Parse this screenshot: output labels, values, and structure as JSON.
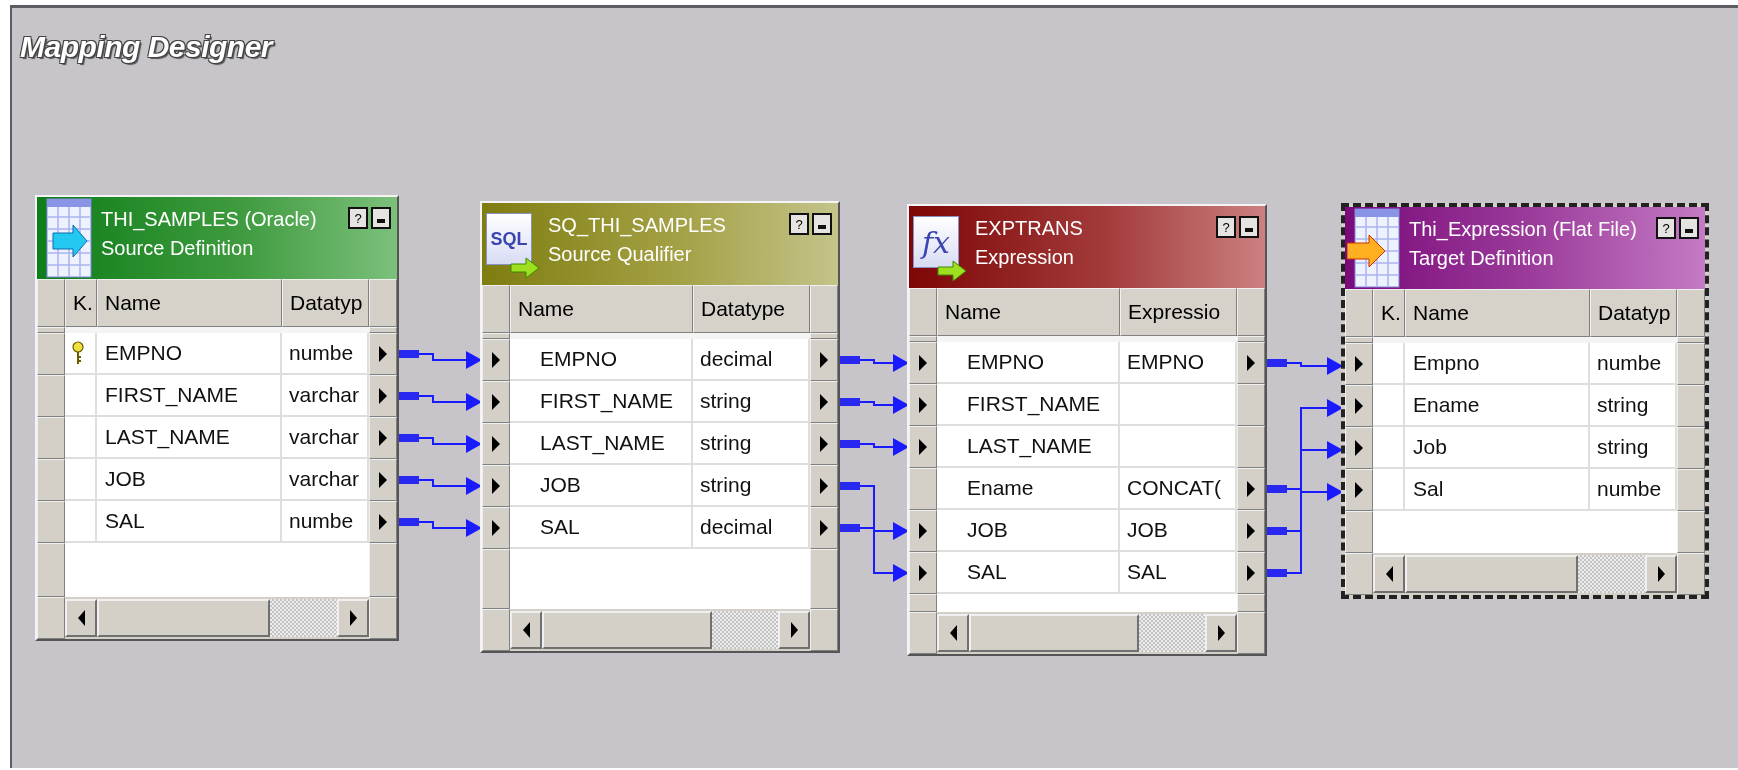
{
  "window": {
    "title": "Mapping Designer"
  },
  "nodes": [
    {
      "kind": "source",
      "selected": false,
      "title": "THI_SAMPLES (Oracle)",
      "subtitle": "Source Definition",
      "help": "?",
      "columns": [
        "K.",
        "Name",
        "Datatyp"
      ],
      "rows": [
        {
          "key": true,
          "name": "EMPNO",
          "value": "numbe",
          "input": false,
          "output": true
        },
        {
          "key": false,
          "name": "FIRST_NAME",
          "value": "varchar",
          "input": false,
          "output": true
        },
        {
          "key": false,
          "name": "LAST_NAME",
          "value": "varchar",
          "input": false,
          "output": true
        },
        {
          "key": false,
          "name": "JOB",
          "value": "varchar",
          "input": false,
          "output": true
        },
        {
          "key": false,
          "name": "SAL",
          "value": "numbe",
          "input": false,
          "output": true
        }
      ]
    },
    {
      "kind": "qualifier",
      "selected": false,
      "icon_label": "SQL",
      "title": "SQ_THI_SAMPLES",
      "subtitle": "Source Qualifier",
      "help": "?",
      "columns": [
        "Name",
        "Datatype"
      ],
      "rows": [
        {
          "name": "EMPNO",
          "value": "decimal",
          "input": true,
          "output": true
        },
        {
          "name": "FIRST_NAME",
          "value": "string",
          "input": true,
          "output": true
        },
        {
          "name": "LAST_NAME",
          "value": "string",
          "input": true,
          "output": true
        },
        {
          "name": "JOB",
          "value": "string",
          "input": true,
          "output": true
        },
        {
          "name": "SAL",
          "value": "decimal",
          "input": true,
          "output": true
        }
      ]
    },
    {
      "kind": "expression",
      "selected": false,
      "icon_label": "fx",
      "title": "EXPTRANS",
      "subtitle": "Expression",
      "help": "?",
      "columns": [
        "Name",
        "Expressio"
      ],
      "rows": [
        {
          "name": "EMPNO",
          "value": "EMPNO",
          "input": true,
          "output": true
        },
        {
          "name": "FIRST_NAME",
          "input": true,
          "output": false
        },
        {
          "name": "LAST_NAME",
          "input": true,
          "output": false
        },
        {
          "name": "Ename",
          "value": "CONCAT(",
          "input": false,
          "output": true
        },
        {
          "name": "JOB",
          "value": "JOB",
          "input": true,
          "output": true
        },
        {
          "name": "SAL",
          "value": "SAL",
          "input": true,
          "output": true
        }
      ]
    },
    {
      "kind": "target",
      "selected": true,
      "title": "Thi_Expression (Flat File)",
      "subtitle": "Target Definition",
      "help": "?",
      "columns": [
        "K.",
        "Name",
        "Datatyp"
      ],
      "rows": [
        {
          "key": false,
          "name": "Empno",
          "value": "numbe",
          "input": true,
          "output": false
        },
        {
          "key": false,
          "name": "Ename",
          "value": "string",
          "input": true,
          "output": false
        },
        {
          "key": false,
          "name": "Job",
          "value": "string",
          "input": true,
          "output": false
        },
        {
          "key": false,
          "name": "Sal",
          "value": "numbe",
          "input": true,
          "output": false
        }
      ]
    }
  ]
}
